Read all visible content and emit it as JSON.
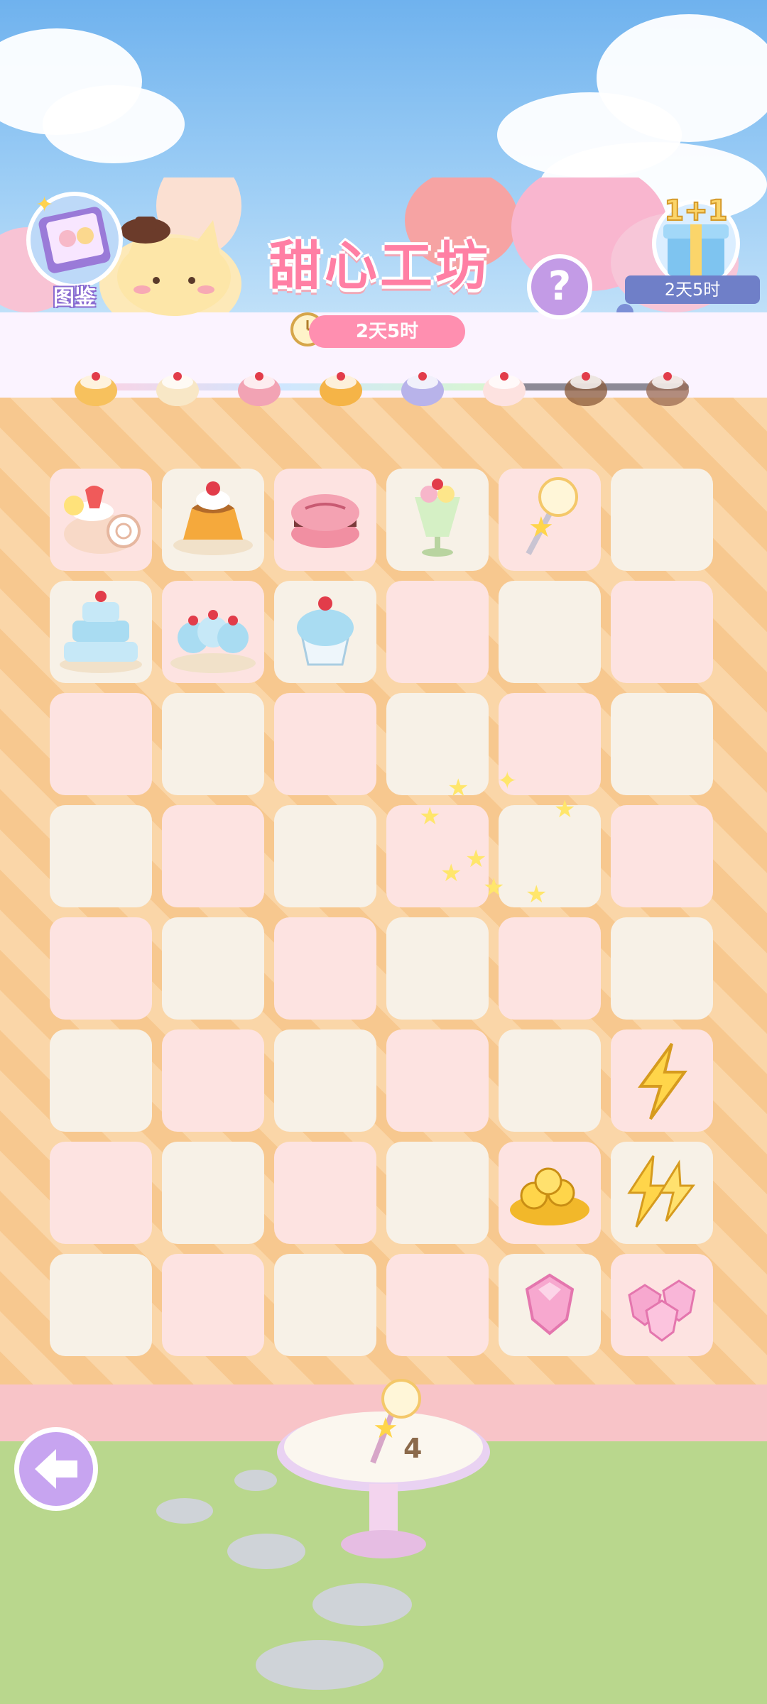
{
  "header": {
    "title": "甜心工坊",
    "event_timer": "2天5时",
    "help_label": "?"
  },
  "codex_button": {
    "label": "图鉴",
    "icon": "recipe-book-icon"
  },
  "gift_button": {
    "badge_text": "1+1",
    "timer": "2天5时",
    "icon": "gift-box-icon"
  },
  "progress_track": {
    "items": [
      "cream-puff-icon",
      "donut-icon",
      "macaron-icon",
      "pudding-icon",
      "blueberry-cake-slice-icon",
      "strawberry-roll-icon",
      "chocolate-cake-icon",
      "bunny-cake-icon"
    ],
    "unlocked_count": 6
  },
  "board": {
    "rows": 8,
    "cols": 6,
    "cells": [
      [
        "strawberry-roll-cake",
        "pudding",
        "macaron",
        "parfait",
        "magic-wand",
        "empty"
      ],
      [
        "cupcake-tower",
        "cupcake-platter",
        "cupcake",
        "empty",
        "empty",
        "empty"
      ],
      [
        "empty",
        "empty",
        "empty",
        "empty",
        "empty",
        "empty"
      ],
      [
        "empty",
        "empty",
        "empty",
        "empty",
        "empty",
        "empty"
      ],
      [
        "empty",
        "empty",
        "empty",
        "empty",
        "empty",
        "empty"
      ],
      [
        "empty",
        "empty",
        "empty",
        "empty",
        "empty",
        "lightning-energy"
      ],
      [
        "empty",
        "empty",
        "empty",
        "empty",
        "gold-coins-pile",
        "lightning-energy-pile"
      ],
      [
        "empty",
        "empty",
        "empty",
        "empty",
        "pink-gem",
        "pink-gems-pile"
      ]
    ]
  },
  "wand_stand": {
    "count": "4",
    "icon": "magic-wand-icon"
  },
  "back_button": {
    "icon": "back-arrow-icon"
  },
  "colors": {
    "pink_cell": "#fde3e1",
    "cream_cell": "#f7f1e7",
    "accent": "#ff7fa4",
    "purple": "#c39be6"
  }
}
